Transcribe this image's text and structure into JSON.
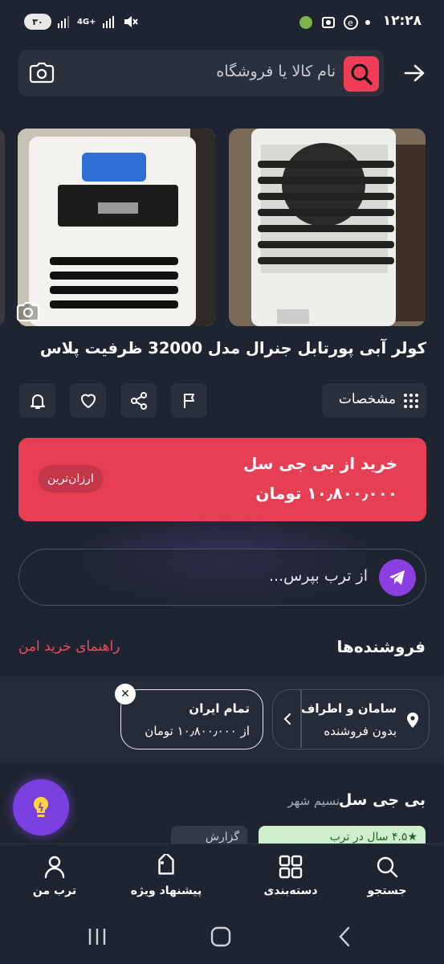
{
  "status_bar": {
    "time": "۱۲:۲۸",
    "battery": "۳۰",
    "network": "4G+"
  },
  "search": {
    "placeholder": "نام کالا یا فروشگاه"
  },
  "product": {
    "title": "کولر آبی پورتابل جنرال مدل 32000 ظرفیت پلاس"
  },
  "actions": {
    "specs_label": "مشخصات"
  },
  "buy_card": {
    "title": "خرید از بی جی سل",
    "price": "۱۰٫۸۰۰٫۰۰۰ تومان",
    "badge": "ارزان‌ترین",
    "color": "#e63f54"
  },
  "ask": {
    "placeholder": "از ترب بپرس..."
  },
  "sellers": {
    "title": "فروشنده‌ها",
    "safe_guide": "راهنمای خرید امن"
  },
  "filters": {
    "location_title": "سامان و اطراف",
    "location_sub": "بدون فروشنده",
    "region_title": "تمام ایران",
    "region_sub": "از ۱۰٫۸۰۰٫۰۰۰ تومان"
  },
  "seller_card": {
    "name": "بی جی سل",
    "city": "نسیم شهر",
    "rating_badge": "★۴.۵ سال در ترب",
    "report_label": "گزارش"
  },
  "bottom_nav": {
    "items": [
      {
        "label": "جستجو",
        "icon": "search-icon"
      },
      {
        "label": "دسته‌بندی",
        "icon": "grid-icon"
      },
      {
        "label": "پیشنهاد ویژه",
        "icon": "tag-icon"
      },
      {
        "label": "ترب من",
        "icon": "user-icon"
      }
    ]
  },
  "colors": {
    "accent_red": "#ef3d55",
    "accent_purple": "#8b3fe0",
    "background": "#1e2530"
  }
}
